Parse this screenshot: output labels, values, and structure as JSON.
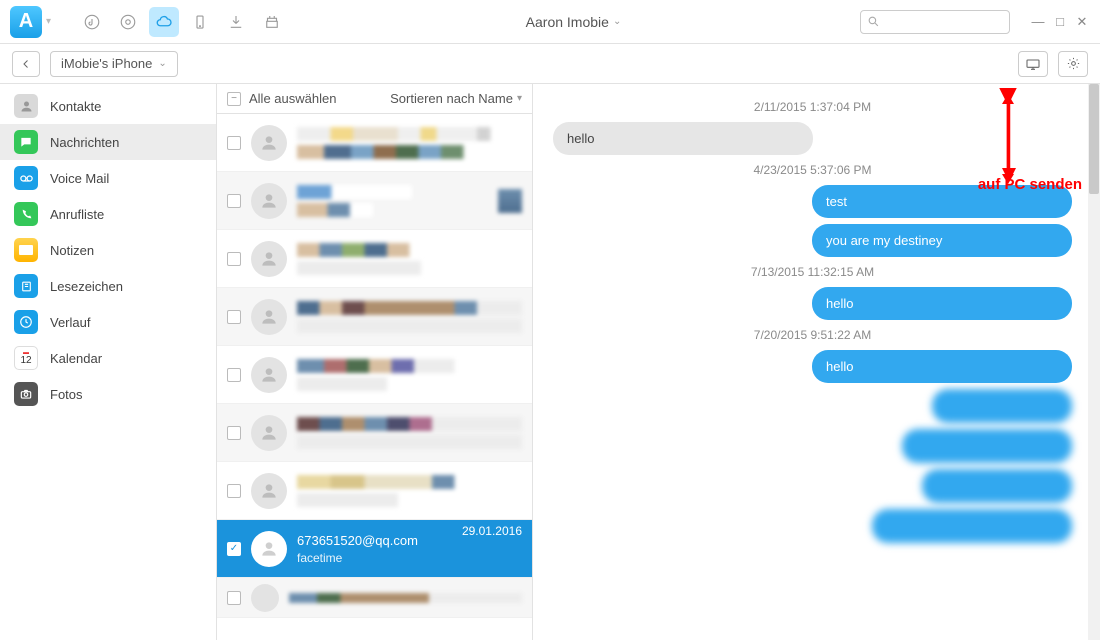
{
  "topbar": {
    "account": "Aaron  Imobie",
    "search_placeholder": ""
  },
  "secondbar": {
    "device": "iMobie's iPhone"
  },
  "sidebar": {
    "items": [
      {
        "label": "Kontakte",
        "iconbg": "#d0d0d0"
      },
      {
        "label": "Nachrichten",
        "iconbg": "#34c759"
      },
      {
        "label": "Voice Mail",
        "iconbg": "#1aa0e8"
      },
      {
        "label": "Anrufliste",
        "iconbg": "#34c759"
      },
      {
        "label": "Notizen",
        "iconbg": "#ffcc00"
      },
      {
        "label": "Lesezeichen",
        "iconbg": "#1aa0e8"
      },
      {
        "label": "Verlauf",
        "iconbg": "#1aa0e8"
      },
      {
        "label": "Kalendar",
        "iconbg": "#ffffff"
      },
      {
        "label": "Fotos",
        "iconbg": "#555555"
      }
    ],
    "active_index": 1
  },
  "contacts_header": {
    "select_all": "Alle auswählen",
    "sort_label": "Sortieren nach Name"
  },
  "selected_contact": {
    "name": "673651520@qq.com",
    "sub": "facetime",
    "date": "29.01.2016"
  },
  "conversation": {
    "ts1": "2/11/2015 1:37:04 PM",
    "in1": "hello",
    "ts2": "4/23/2015 5:37:06 PM",
    "out1": "test",
    "out2": "you are my destiney",
    "ts3": "7/13/2015 11:32:15 AM",
    "out3": "hello",
    "ts4": "7/20/2015 9:51:22 AM",
    "out4": "hello"
  },
  "annotation": "auf PC senden"
}
